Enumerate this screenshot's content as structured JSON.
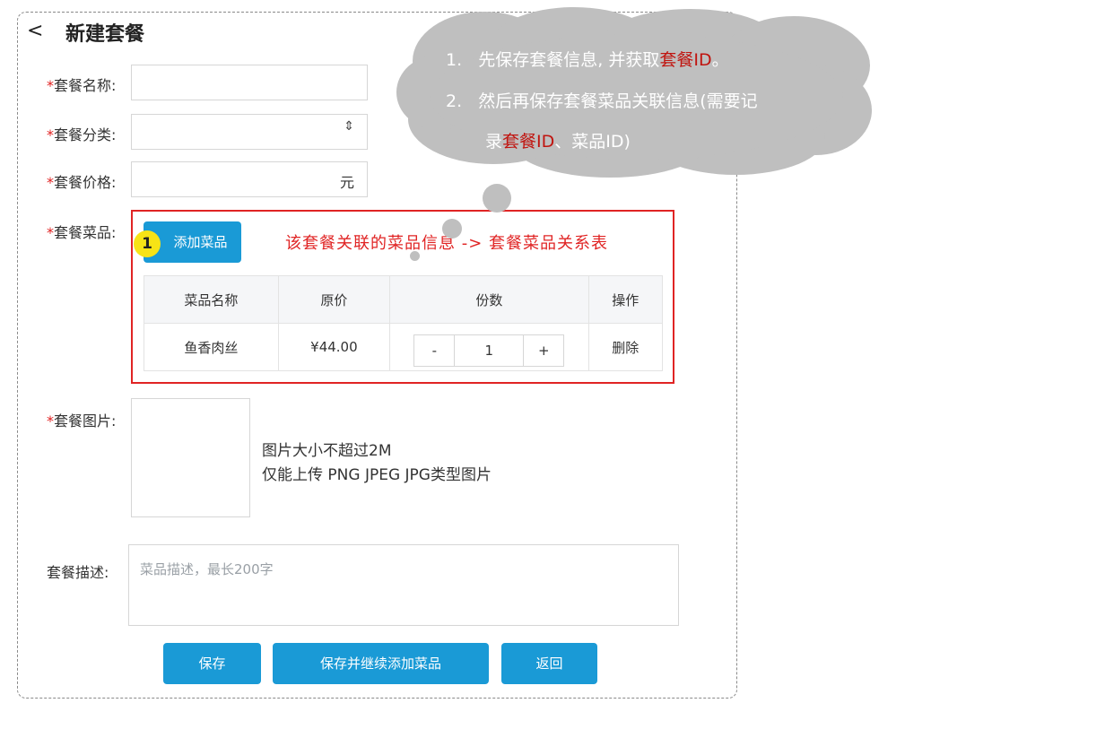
{
  "header": {
    "title": "新建套餐",
    "back_icon": "<"
  },
  "form": {
    "required_mark": "*",
    "name": {
      "label": "套餐名称:",
      "value": ""
    },
    "category": {
      "label": "套餐分类:",
      "value": "",
      "arrows": "⇕"
    },
    "price": {
      "label": "套餐价格:",
      "value": "",
      "unit": "元"
    },
    "dishes": {
      "label": "套餐菜品:",
      "add_button": "添加菜品",
      "step_badge": "1",
      "annotation": "该套餐关联的菜品信息 -> 套餐菜品关系表",
      "columns": [
        "菜品名称",
        "原价",
        "份数",
        "操作"
      ],
      "rows": [
        {
          "name": "鱼香肉丝",
          "price": "¥44.00",
          "minus": "-",
          "qty": "1",
          "plus": "+",
          "action": "删除"
        }
      ]
    },
    "image": {
      "label": "套餐图片:",
      "hint_line1": "图片大小不超过2M",
      "hint_line2": "仅能上传 PNG JPEG JPG类型图片"
    },
    "description": {
      "label": "套餐描述:",
      "placeholder": "菜品描述，最长200字"
    }
  },
  "actions": {
    "save": "保存",
    "save_continue": "保存并继续添加菜品",
    "back": "返回"
  },
  "callout": {
    "line1_num": "1.",
    "line1_pre": "先保存套餐信息, 并获取",
    "line1_hl": "套餐ID",
    "line1_post": "。",
    "line2_num": "2.",
    "line2": "然后再保存套餐菜品关联信息(需要记",
    "line3_pre": "录",
    "line3_hl": "套餐ID",
    "line3_post": "、菜品ID)"
  },
  "colors": {
    "primary": "#1a9ad6",
    "highlight_red": "#e02424",
    "cloud_gray": "#bfbfbf",
    "badge_yellow": "#f7e316"
  }
}
